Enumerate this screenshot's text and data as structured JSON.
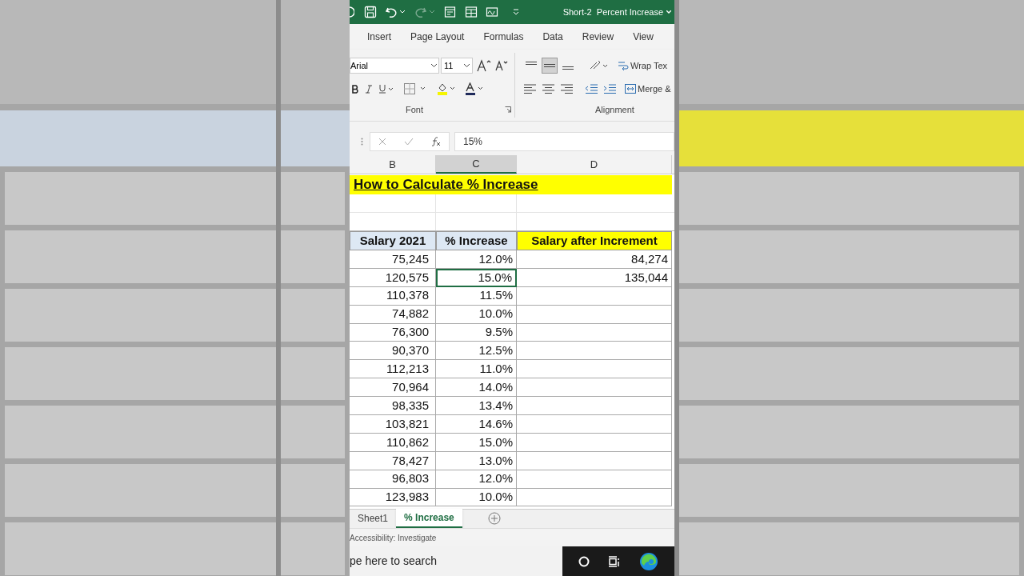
{
  "title_bar": {
    "document_title": "Short-2  Percent Increase"
  },
  "ribbon_tabs": [
    "Insert",
    "Page Layout",
    "Formulas",
    "Data",
    "Review",
    "View"
  ],
  "font_group": {
    "font_name": "Arial",
    "font_size": "11",
    "label": "Font"
  },
  "alignment_group": {
    "vertical_align_buttons": [
      {
        "selected": false
      },
      {
        "selected": true
      },
      {
        "selected": false
      }
    ],
    "wrap_text": "Wrap Tex",
    "merge": "Merge &",
    "label": "Alignment"
  },
  "formula_bar": {
    "value": "15%"
  },
  "columns": [
    {
      "label": "B",
      "selected": false
    },
    {
      "label": "C",
      "selected": true
    },
    {
      "label": "D",
      "selected": false
    }
  ],
  "sheet": {
    "title": "How to Calculate % Increase",
    "headers": [
      "Salary 2021",
      "% Increase",
      "Salary after Increment"
    ],
    "rows": [
      {
        "salary": "75,245",
        "increase": "12.0%",
        "increase_selected": false,
        "after": "84,274"
      },
      {
        "salary": "120,575",
        "increase": "15.0%",
        "increase_selected": true,
        "after": "135,044"
      },
      {
        "salary": "110,378",
        "increase": "11.5%",
        "increase_selected": false
      },
      {
        "salary": "74,882",
        "increase": "10.0%",
        "increase_selected": false
      },
      {
        "salary": "76,300",
        "increase": "9.5%",
        "increase_selected": false
      },
      {
        "salary": "90,370",
        "increase": "12.5%",
        "increase_selected": false
      },
      {
        "salary": "112,213",
        "increase": "11.0%",
        "increase_selected": false
      },
      {
        "salary": "70,964",
        "increase": "14.0%",
        "increase_selected": false
      },
      {
        "salary": "98,335",
        "increase": "13.4%",
        "increase_selected": false
      },
      {
        "salary": "103,821",
        "increase": "14.6%",
        "increase_selected": false
      },
      {
        "salary": "110,862",
        "increase": "15.0%",
        "increase_selected": false
      },
      {
        "salary": "78,427",
        "increase": "13.0%",
        "increase_selected": false
      },
      {
        "salary": "96,803",
        "increase": "12.0%",
        "increase_selected": false
      },
      {
        "salary": "123,983",
        "increase": "10.0%",
        "increase_selected": false
      }
    ]
  },
  "sheet_tabs": [
    {
      "label": "Sheet1",
      "selected": false
    },
    {
      "label": "% Increase",
      "selected": true
    }
  ],
  "status_bar": {
    "text": "Accessibility: Investigate"
  },
  "taskbar": {
    "search_placeholder": "pe here to search"
  }
}
